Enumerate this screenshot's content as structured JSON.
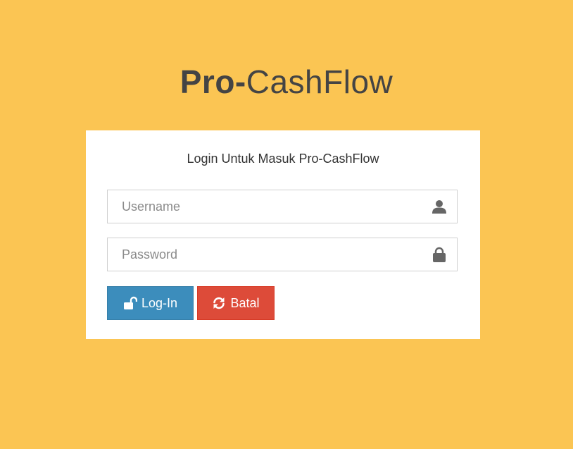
{
  "logo": {
    "bold": "Pro-",
    "light": "CashFlow"
  },
  "login": {
    "title": "Login Untuk Masuk Pro-CashFlow",
    "username_placeholder": "Username",
    "username_icon": "user-icon",
    "password_placeholder": "Password",
    "password_icon": "lock-icon",
    "login_label": "Log-In",
    "login_icon": "unlock-icon",
    "cancel_label": "Batal",
    "cancel_icon": "refresh-icon"
  },
  "colors": {
    "background": "#fbc553",
    "card": "#ffffff",
    "login_button": "#3c8dbc",
    "cancel_button": "#dd4b39",
    "logo_text": "#444444"
  }
}
